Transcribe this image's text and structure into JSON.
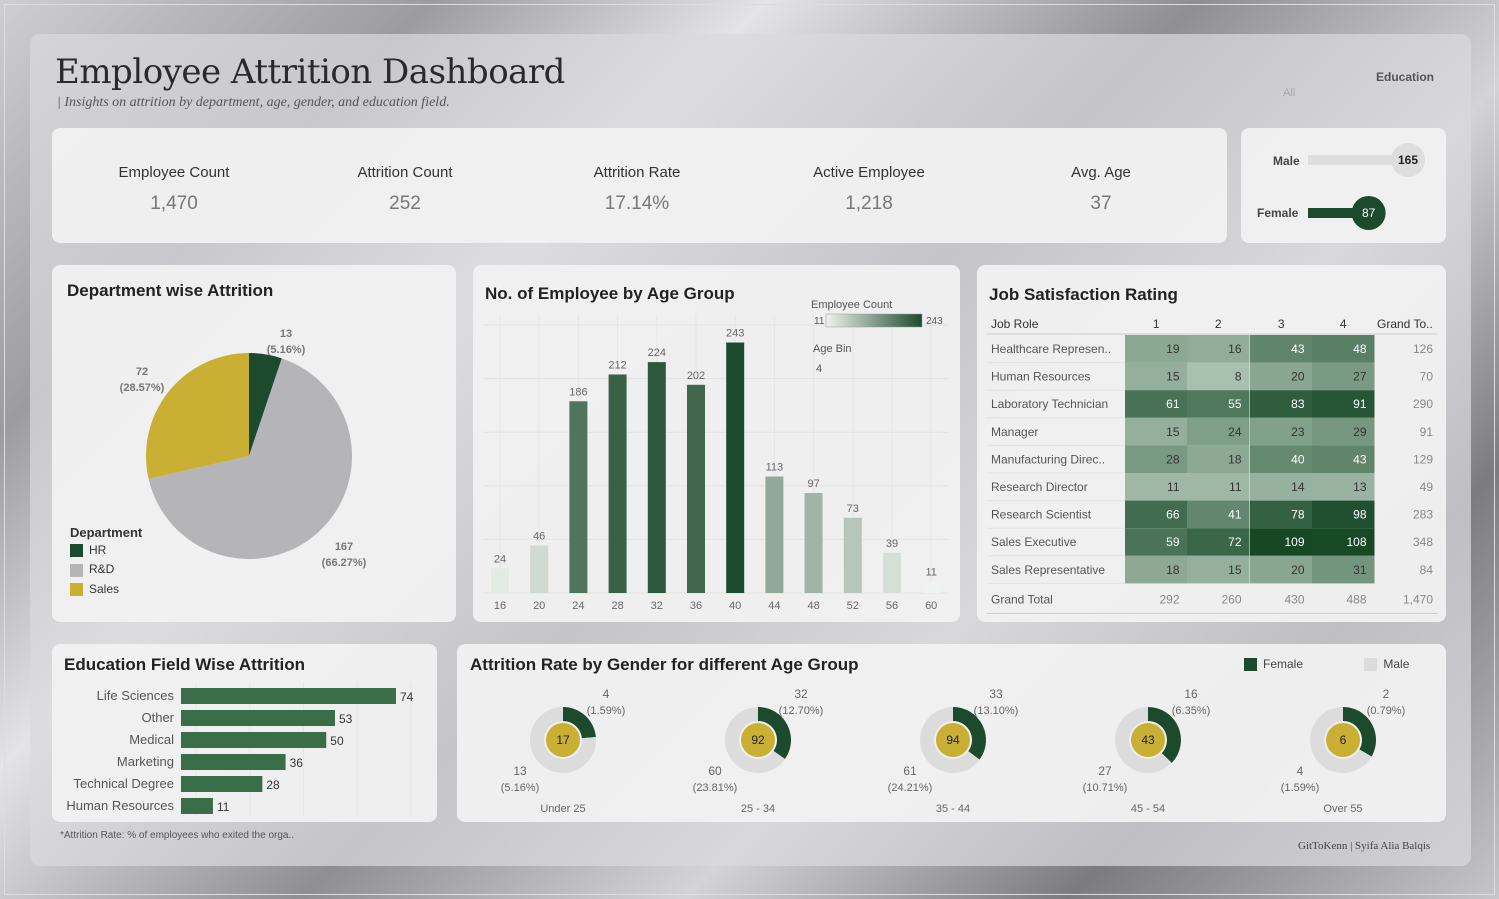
{
  "header": {
    "title": "Employee Attrition Dashboard",
    "subtitle": "| Insights on attrition by department, age, gender, and education field.",
    "filter_label": "Education",
    "filter_value": "All"
  },
  "kpis": [
    {
      "label": "Employee Count",
      "value": "1,470"
    },
    {
      "label": "Attrition Count",
      "value": "252"
    },
    {
      "label": "Attrition Rate",
      "value": "17.14%"
    },
    {
      "label": "Active Employee",
      "value": "1,218"
    },
    {
      "label": "Avg. Age",
      "value": "37"
    }
  ],
  "gender_counts": {
    "male_label": "Male",
    "male_value": "165",
    "male_num": 165,
    "female_label": "Female",
    "female_value": "87",
    "female_num": 87
  },
  "colors": {
    "dark_green": "#1c4a2c",
    "green": "#3a6e49",
    "mid_green": "#6fa07d",
    "light_green": "#c6dcc9",
    "gold": "#c9b035",
    "gray": "#b5b5b7",
    "light_gray": "#dcdcdc"
  },
  "chart_data": [
    {
      "type": "pie",
      "title": "Department wise Attrition",
      "legend_title": "Department",
      "legend_position": "bottom-left",
      "slices": [
        {
          "label": "HR",
          "value": 13,
          "display": "13",
          "pct": "(5.16%)",
          "color": "#1c4a2c"
        },
        {
          "label": "R&D",
          "value": 167,
          "display": "167",
          "pct": "(66.27%)",
          "color": "#b5b5b7"
        },
        {
          "label": "Sales",
          "value": 72,
          "display": "72",
          "pct": "(28.57%)",
          "color": "#c9b035"
        }
      ]
    },
    {
      "type": "bar",
      "title": "No. of Employee by Age Group",
      "legend": {
        "title": "Employee Count",
        "min": "11",
        "max": "243",
        "bin_title": "Age Bin",
        "bin_value": "4"
      },
      "categories": [
        "16",
        "20",
        "24",
        "28",
        "32",
        "36",
        "40",
        "44",
        "48",
        "52",
        "56",
        "60"
      ],
      "values": [
        24,
        46,
        186,
        212,
        224,
        202,
        243,
        113,
        97,
        73,
        39,
        11
      ],
      "ylim": [
        0,
        260
      ],
      "grid": true
    },
    {
      "type": "heatmap",
      "title": "Job Satisfaction Rating",
      "row_header": "Job Role",
      "columns": [
        "1",
        "2",
        "3",
        "4"
      ],
      "total_header": "Grand To..",
      "rows": [
        {
          "label": "Healthcare Represen..",
          "values": [
            19,
            16,
            43,
            48
          ],
          "total": 126
        },
        {
          "label": "Human Resources",
          "values": [
            15,
            8,
            20,
            27
          ],
          "total": 70
        },
        {
          "label": "Laboratory Technician",
          "values": [
            61,
            55,
            83,
            91
          ],
          "total": 290
        },
        {
          "label": "Manager",
          "values": [
            15,
            24,
            23,
            29
          ],
          "total": 91
        },
        {
          "label": "Manufacturing Direc..",
          "values": [
            28,
            18,
            40,
            43
          ],
          "total": 129
        },
        {
          "label": "Research Director",
          "values": [
            11,
            11,
            14,
            13
          ],
          "total": 49
        },
        {
          "label": "Research Scientist",
          "values": [
            66,
            41,
            78,
            98
          ],
          "total": 283
        },
        {
          "label": "Sales Executive",
          "values": [
            59,
            72,
            109,
            108
          ],
          "total": 348
        },
        {
          "label": "Sales Representative",
          "values": [
            18,
            15,
            20,
            31
          ],
          "total": 84
        }
      ],
      "grand_total": {
        "label": "Grand Total",
        "values": [
          292,
          260,
          430,
          488
        ],
        "total": "1,470"
      }
    },
    {
      "type": "bar",
      "orientation": "horizontal",
      "title": "Education Field Wise Attrition",
      "categories": [
        "Life Sciences",
        "Other",
        "Medical",
        "Marketing",
        "Technical Degree",
        "Human Resources"
      ],
      "values": [
        74,
        53,
        50,
        36,
        28,
        11
      ]
    },
    {
      "type": "pie",
      "subtype": "donut",
      "title": "Attrition Rate by Gender for different Age Group",
      "legend": [
        {
          "label": "Female",
          "color": "#1c4a2c"
        },
        {
          "label": "Male",
          "color": "#dcdcdc"
        }
      ],
      "groups": [
        {
          "label": "Under 25",
          "total": "17",
          "female": 4,
          "female_pct": "(1.59%)",
          "male": 13,
          "male_pct": "(5.16%)"
        },
        {
          "label": "25 - 34",
          "total": "92",
          "female": 32,
          "female_pct": "(12.70%)",
          "male": 60,
          "male_pct": "(23.81%)"
        },
        {
          "label": "35 - 44",
          "total": "94",
          "female": 33,
          "female_pct": "(13.10%)",
          "male": 61,
          "male_pct": "(24.21%)"
        },
        {
          "label": "45 - 54",
          "total": "43",
          "female": 16,
          "female_pct": "(6.35%)",
          "male": 27,
          "male_pct": "(10.71%)"
        },
        {
          "label": "Over 55",
          "total": "6",
          "female": 2,
          "female_pct": "(0.79%)",
          "male": 4,
          "male_pct": "(1.59%)"
        }
      ]
    }
  ],
  "footer": {
    "footnote": "*Attrition Rate: % of employees who exited the orga..",
    "credit": "GitToKenn | Syifa Alia Balqis"
  }
}
